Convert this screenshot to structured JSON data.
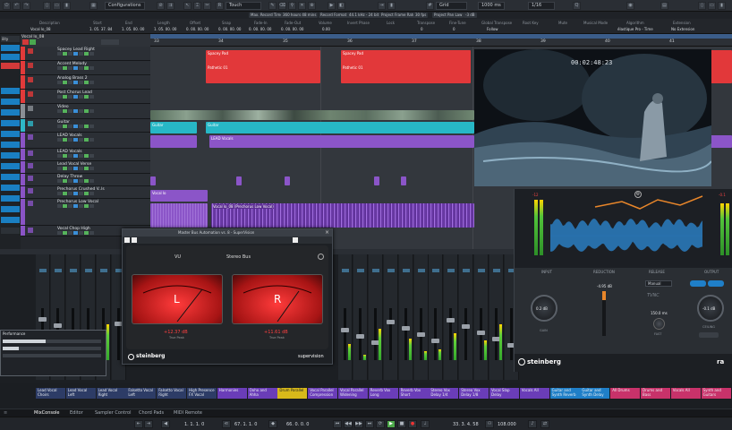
{
  "toolbar": {
    "configurations": "Configurations",
    "automation_mode": "Touch",
    "grid_type": "Grid",
    "quantize": "1/16",
    "nudge": "1000 ms"
  },
  "status": [
    {
      "label": "Max. Record Time"
    },
    {
      "label": "360 hours 48 mins"
    },
    {
      "label": "Record Format"
    },
    {
      "label": "44.1 kHz - 24 bit"
    },
    {
      "label": "Project Frame Rate"
    },
    {
      "label": "30 fps"
    },
    {
      "label": "Project Pan Law"
    },
    {
      "label": "-3 dB"
    }
  ],
  "info_line": {
    "headers": [
      "Description",
      "Start",
      "End",
      "Length",
      "Offset",
      "Snap",
      "Fade-In",
      "Fade-Out",
      "Volume",
      "Invert Phase",
      "Lock",
      "Transpose",
      "Fine-Tune",
      "Global Transpose",
      "Root Key",
      "Mute",
      "Musical Mode",
      "Algorithm",
      "Extension"
    ],
    "values": [
      "Vocal lo_08",
      "1. 05. 37. 84",
      "1. 05. 00. 00",
      "1. 05. 00. 00",
      "0. 00. 00. 00",
      "0. 00. 00. 00",
      "0. 00. 00. 00",
      "0. 00. 00. 00",
      "0.00",
      "",
      "",
      "0",
      "0",
      "Follow",
      "",
      "",
      "",
      "élastique Pro - Time",
      "No Extension"
    ]
  },
  "track_name_header": "Vocal lo_08",
  "tracks": [
    {
      "name": "Spacey Lead Right",
      "color": "#e23a3a"
    },
    {
      "name": "Accent Melody",
      "color": "#e23a3a"
    },
    {
      "name": "Analog Brass 2",
      "color": "#e23a3a"
    },
    {
      "name": "Post Chorus Lead",
      "color": "#e23a3a"
    },
    {
      "name": "Video",
      "color": "#8a8f95"
    },
    {
      "name": "Guitar",
      "color": "#2eb8c8"
    },
    {
      "name": "LEAD Vocals",
      "color": "#8a54c6"
    },
    {
      "name": "LEAD Vocals",
      "color": "#8a54c6"
    },
    {
      "name": "Lead Vocal Verse",
      "color": "#8a54c6"
    },
    {
      "name": "Delay Throw",
      "color": "#8a54c6"
    },
    {
      "name": "Prechorus Crushed V..ls",
      "color": "#8a54c6"
    },
    {
      "name": "Prechorus Low Vocal",
      "color": "#8a54c6"
    },
    {
      "name": "Vocal Chop High",
      "color": "#8a54c6"
    }
  ],
  "ruler_numbers": [
    "33",
    "34",
    "35",
    "36",
    "37",
    "38",
    "39",
    "40",
    "41"
  ],
  "clips": {
    "spacey1": "Spacey Pad",
    "spacey2": "Spacey Pad",
    "post1": "Pathetic 01",
    "post2": "Pathetic 01",
    "guitar1": "Guitar",
    "guitar2": "Guitar",
    "lead1": "LEAD Vocals",
    "lead2": "LEAD Vocals",
    "prelow": "Vocal lo_08 (Prechorus Low Vocal)",
    "crushed": "Vocal lo"
  },
  "video": {
    "timecode": "00:02:48:23"
  },
  "supervision": {
    "title": "Master Bus Automation vs. 8 - SuperVision",
    "meter_type": "VU",
    "channel": "Stereo Bus",
    "left_letter": "L",
    "right_letter": "R",
    "left_db": "+12.37 dB",
    "right_db": "+11.61 dB",
    "true_peak": "True Peak",
    "brand": "steinberg",
    "product": "supervision"
  },
  "compressor": {
    "input_label": "INPUT",
    "reduction_label": "REDUCTION",
    "release_label": "RELEASE",
    "output_label": "OUTPUT",
    "input_value": "0.2 dB",
    "reduction_value": "-4.95 dB",
    "release_mode": "Manual",
    "release_value": "150.0 ms",
    "output_value": "-0.1 dB",
    "gain_label": "GAIN",
    "fast_label": "FAST",
    "ceiling_label": "CEILING",
    "brand": "steinberg",
    "product_fragment": "ra",
    "left_meter_top": "-12",
    "right_meter_top": "-0.1"
  },
  "performance": {
    "title": "Performance"
  },
  "channel_names": [
    {
      "name": "Lead Vocal Choirs",
      "color": "#2d3c66"
    },
    {
      "name": "Lead Vocal Left",
      "color": "#2d3c66"
    },
    {
      "name": "Lead Vocal Right",
      "color": "#2d3c66"
    },
    {
      "name": "Falsetto Vocal Left",
      "color": "#2d3c66"
    },
    {
      "name": "Falsetto Vocal Right",
      "color": "#2d3c66"
    },
    {
      "name": "High Presence FX Vocal",
      "color": "#2d3c66"
    },
    {
      "name": "Harmonies",
      "color": "#6a3db8"
    },
    {
      "name": "Ooho and Ahha",
      "color": "#6a3db8"
    },
    {
      "name": "Drum Parallel",
      "color": "#d8b91a"
    },
    {
      "name": "Vocal Parallel Compression",
      "color": "#6a3db8"
    },
    {
      "name": "Vocal Parallel Widening",
      "color": "#6a3db8"
    },
    {
      "name": "Reverb Vox Long",
      "color": "#6a3db8"
    },
    {
      "name": "Reverb Vox Short",
      "color": "#6a3db8"
    },
    {
      "name": "Stereo Vox Delay 1/4",
      "color": "#6a3db8"
    },
    {
      "name": "Stereo Vox Delay 1/8",
      "color": "#6a3db8"
    },
    {
      "name": "Vocal Slap Delay",
      "color": "#6a3db8"
    },
    {
      "name": "Vocals All",
      "color": "#6a3db8"
    },
    {
      "name": "Guitar and Synth Reverb",
      "color": "#1f7fc8"
    },
    {
      "name": "Guitar and Synth Delay",
      "color": "#1f7fc8"
    },
    {
      "name": "All Drums",
      "color": "#c8326a"
    },
    {
      "name": "Drums and Bass",
      "color": "#c8326a"
    },
    {
      "name": "Vocals All",
      "color": "#c8326a"
    },
    {
      "name": "Synth and Guitars",
      "color": "#c8326a"
    }
  ],
  "tabs": [
    "MixConsole",
    "Editor",
    "Sampler Control",
    "Chord Pads",
    "MIDI Remote"
  ],
  "transport": {
    "left_locator": "1. 1. 1. 0",
    "position1": "67. 1. 1. 0",
    "position2": "66. 0. 0. 0",
    "time_display": "33. 3. 4. 58",
    "tempo": "108.000"
  }
}
